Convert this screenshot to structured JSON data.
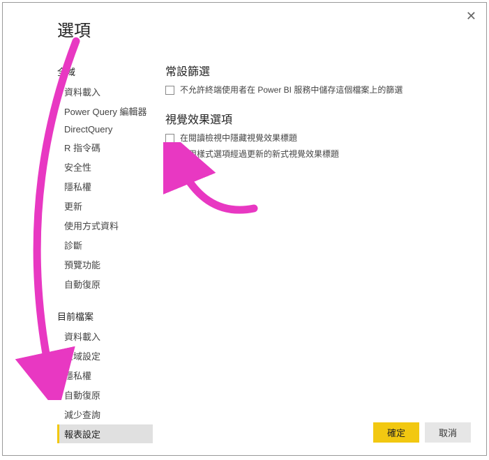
{
  "title": "選項",
  "sidebar": {
    "section1_label": "全域",
    "section1_items": [
      "資料載入",
      "Power Query 編輯器",
      "DirectQuery",
      "R 指令碼",
      "安全性",
      "隱私權",
      "更新",
      "使用方式資料",
      "診斷",
      "預覽功能",
      "自動復原"
    ],
    "section2_label": "目前檔案",
    "section2_items": [
      "資料載入",
      "區域設定",
      "隱私權",
      "自動復原",
      "減少查詢",
      "報表設定"
    ],
    "selected": "報表設定"
  },
  "main": {
    "group1_title": "常設篩選",
    "group1_checkbox1_label": "不允許終端使用者在 Power BI 服務中儲存這個檔案上的篩選",
    "group2_title": "視覺效果選項",
    "group2_checkbox1_label": "在閱讀檢視中隱藏視覺效果標題",
    "group2_checkbox2_label": "使用樣式選項經過更新的新式視覺效果標題"
  },
  "footer": {
    "ok_label": "確定",
    "cancel_label": "取消"
  }
}
